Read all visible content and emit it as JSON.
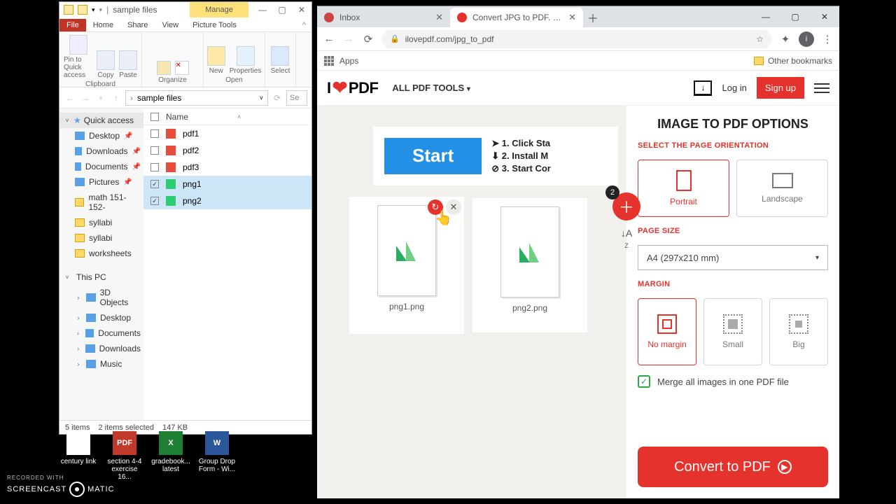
{
  "explorer": {
    "title": "sample files",
    "manage": "Manage",
    "tabs": {
      "file": "File",
      "home": "Home",
      "share": "Share",
      "view": "View",
      "picture": "Picture Tools"
    },
    "ribbon": {
      "clipboard": {
        "label": "Clipboard",
        "pin": "Pin to Quick access",
        "copy": "Copy",
        "paste": "Paste"
      },
      "organize": {
        "label": "Organize"
      },
      "new_grp": {
        "label": "New",
        "new": "New",
        "props": "Properties"
      },
      "open": {
        "label": "Open"
      },
      "select": {
        "label": "Select"
      }
    },
    "path": "sample files",
    "search_ph": "Se",
    "columns": {
      "name": "Name"
    },
    "quick": {
      "header": "Quick access",
      "items": [
        "Desktop",
        "Downloads",
        "Documents",
        "Pictures",
        "math 151-152-",
        "syllabi",
        "syllabi",
        "worksheets"
      ]
    },
    "pc": {
      "header": "This PC",
      "items": [
        "3D Objects",
        "Desktop",
        "Documents",
        "Downloads",
        "Music"
      ]
    },
    "files": [
      {
        "name": "pdf1",
        "type": "pdf",
        "sel": false
      },
      {
        "name": "pdf2",
        "type": "pdf",
        "sel": false
      },
      {
        "name": "pdf3",
        "type": "pdf",
        "sel": false
      },
      {
        "name": "png1",
        "type": "img",
        "sel": true
      },
      {
        "name": "png2",
        "type": "img",
        "sel": true
      }
    ],
    "status": {
      "items": "5 items",
      "selected": "2 items selected",
      "size": "147 KB"
    }
  },
  "desktop": {
    "icons": [
      {
        "label": "century link",
        "cls": "db1",
        "abbr": ""
      },
      {
        "label": "section 4-4 exercise 16...",
        "cls": "db2",
        "abbr": "PDF"
      },
      {
        "label": "gradebook... latest",
        "cls": "db3",
        "abbr": "X"
      },
      {
        "label": "Group Drop Form - Wi...",
        "cls": "db4",
        "abbr": "W"
      }
    ]
  },
  "watermark": {
    "top": "RECORDED WITH",
    "brand": "SCREENCAST",
    "suffix": "MATIC"
  },
  "browser": {
    "tabs": [
      {
        "title": "Inbox",
        "color": "#c44"
      },
      {
        "title": "Convert JPG to PDF. Images JPG",
        "color": "#e5322d"
      }
    ],
    "addr": "ilovepdf.com/jpg_to_pdf",
    "bookmarks": {
      "apps": "Apps",
      "other": "Other bookmarks"
    },
    "avatar": "i"
  },
  "site": {
    "logo_pdf": "PDF",
    "alltools": "ALL PDF TOOLS",
    "login": "Log in",
    "signup": "Sign up",
    "ad": {
      "start": "Start",
      "steps": [
        "1. Click Sta",
        "2. Install M",
        "3. Start Cor"
      ]
    },
    "thumbs": [
      "png1.png",
      "png2.png"
    ],
    "fab_badge": "2",
    "panel": {
      "title": "IMAGE TO PDF OPTIONS",
      "orient_label": "SELECT THE PAGE ORIENTATION",
      "orient": {
        "portrait": "Portrait",
        "landscape": "Landscape"
      },
      "size_label": "PAGE SIZE",
      "size_value": "A4 (297x210 mm)",
      "margin_label": "MARGIN",
      "margins": {
        "none": "No margin",
        "small": "Small",
        "big": "Big"
      },
      "merge": "Merge all images in one PDF file",
      "convert": "Convert to PDF"
    }
  }
}
